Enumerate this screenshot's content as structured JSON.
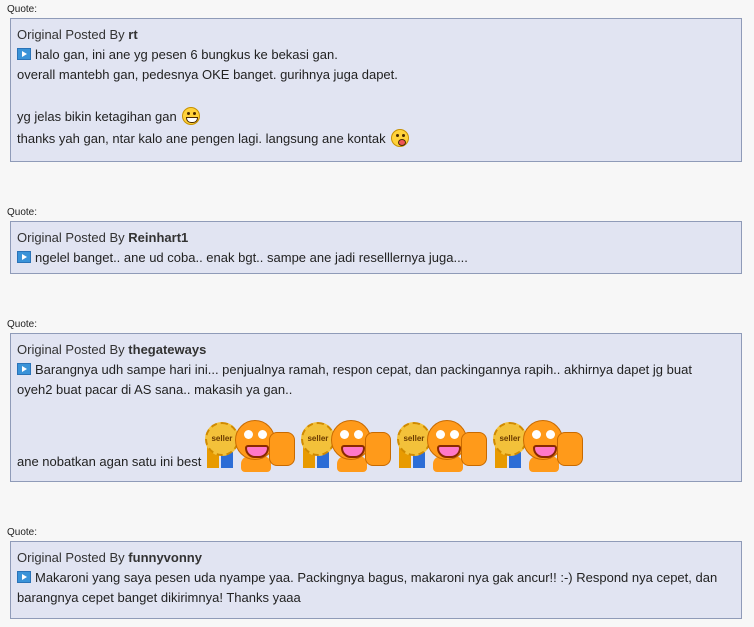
{
  "quote_label": "Quote:",
  "posted_prefix": "Original Posted By",
  "quotes": [
    {
      "author": "rt",
      "lines": [
        "halo gan, ini ane yg pesen 6 bungkus ke bekasi gan.",
        "overall mantebh gan, pedesnya OKE banget. gurihnya juga dapet.",
        "",
        "yg jelas bikin ketagihan gan",
        "thanks yah gan, ntar kalo ane pengen lagi. langsung ane kontak"
      ],
      "emoticons": [
        "grin-smiley-icon",
        "wink-smiley-icon"
      ]
    },
    {
      "author": "Reinhart1",
      "lines": [
        "ngelel banget.. ane ud coba.. enak bgt.. sampe ane jadi reselllernya juga...."
      ]
    },
    {
      "author": "thegateways",
      "lines": [
        "Barangnya udh sampe hari ini... penjualnya ramah, respon cepat, dan packingannya rapih.. akhirnya dapet jg buat oyeh2 buat pacar di AS sana.. makasih ya gan..",
        "ane nobatkan agan satu ini best"
      ],
      "badges": [
        "seller",
        "seller",
        "seller",
        "seller"
      ]
    },
    {
      "author": "funnyvonny",
      "lines": [
        "Makaroni yang saya pesen uda nyampe yaa. Packingnya bagus, makaroni nya gak ancur!! :-) Respond nya cepet, dan barangnya cepet banget dikirimnya! Thanks yaaa"
      ]
    }
  ]
}
